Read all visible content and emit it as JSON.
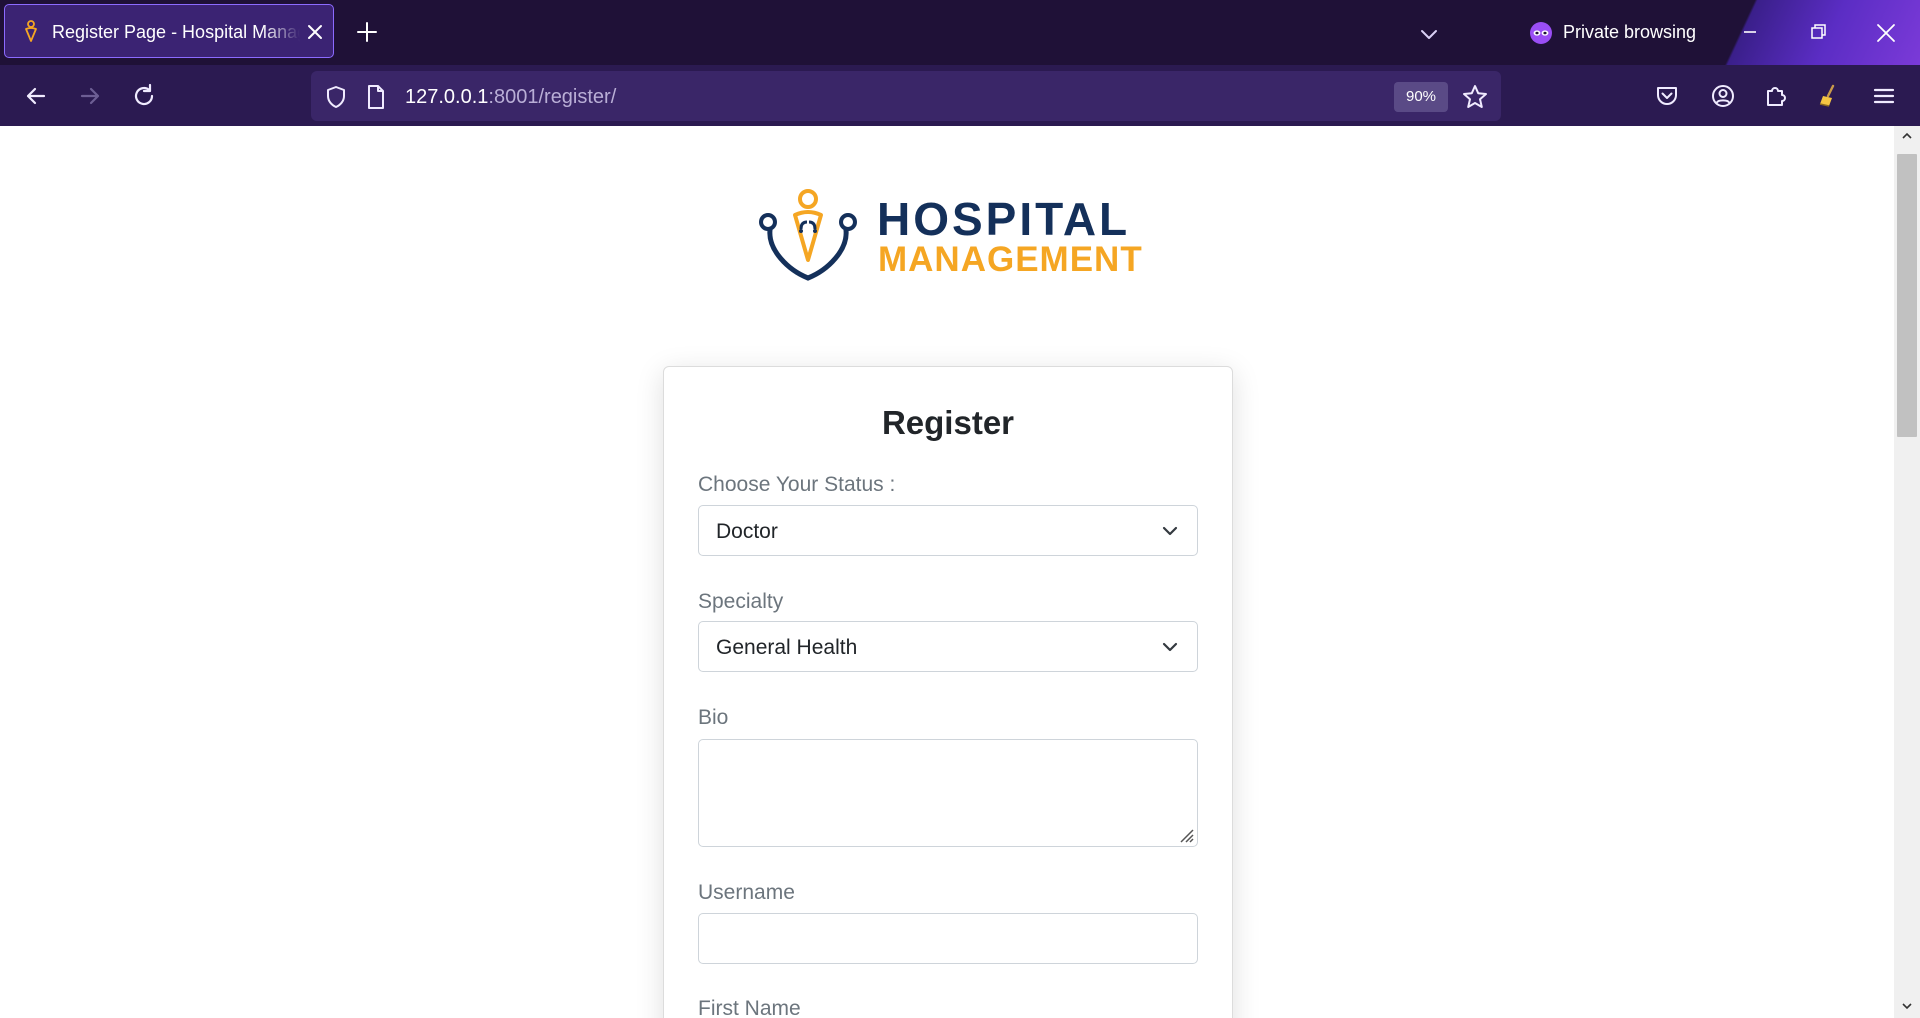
{
  "browser": {
    "tab": {
      "title": "Register Page - Hospital Management",
      "close_icon": "close-icon"
    },
    "new_tab_icon": "plus-icon",
    "tab_list_icon": "chevron-down-icon",
    "private_browsing_label": "Private browsing",
    "url": {
      "host": "127.0.0.1",
      "rest": ":8001/register/"
    },
    "zoom": "90%",
    "colors": {
      "tabbar": "#1f1137",
      "navbar": "#2b1a51",
      "urlbar": "#3a2668",
      "accent": "#8c6bff"
    }
  },
  "page": {
    "logo": {
      "line1": "HOSPITAL",
      "line2": "MANAGEMENT",
      "colors": {
        "primary": "#14305a",
        "secondary": "#f5a623"
      }
    },
    "form": {
      "title": "Register",
      "status_label": "Choose Your Status :",
      "status_value": "Doctor",
      "specialty_label": "Specialty",
      "specialty_value": "General Health",
      "bio_label": "Bio",
      "bio_value": "",
      "username_label": "Username",
      "username_value": "",
      "first_name_label": "First Name"
    }
  }
}
